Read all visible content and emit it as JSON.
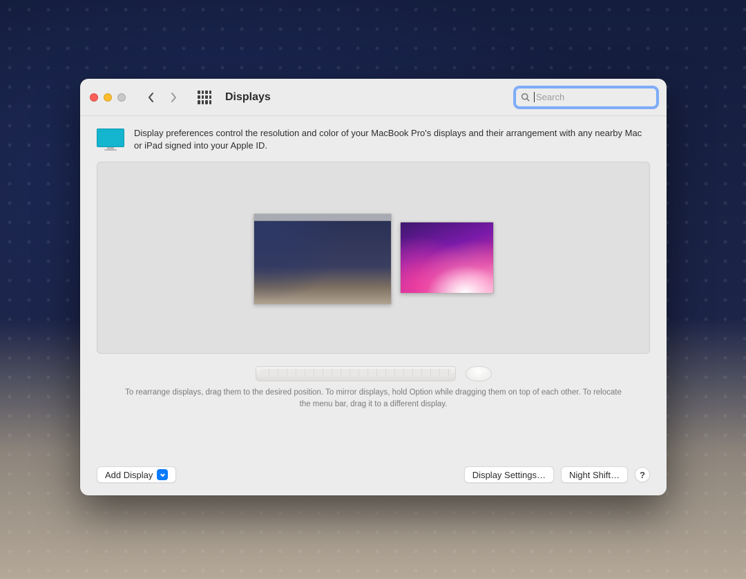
{
  "toolbar": {
    "title": "Displays",
    "search_placeholder": "Search"
  },
  "intro": {
    "text": "Display preferences control the resolution and color of your MacBook Pro's displays and their arrangement with any nearby Mac or iPad signed into your Apple ID."
  },
  "help_text": "To rearrange displays, drag them to the desired position. To mirror displays, hold Option while dragging them on top of each other. To relocate the menu bar, drag it to a different display.",
  "footer": {
    "add_display_label": "Add Display",
    "display_settings_label": "Display Settings…",
    "night_shift_label": "Night Shift…",
    "help_label": "?"
  }
}
